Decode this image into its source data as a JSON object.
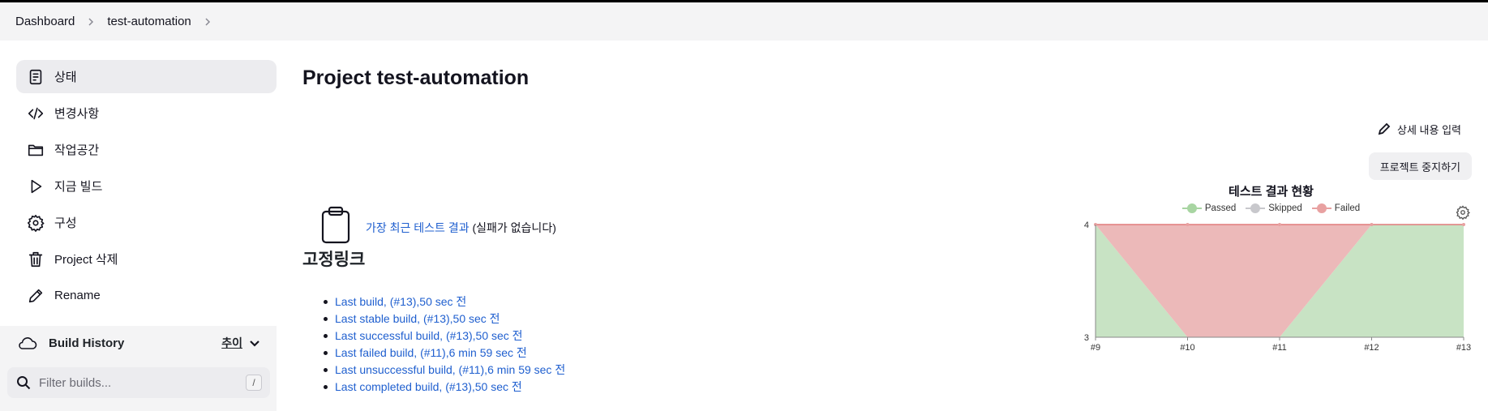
{
  "breadcrumb": {
    "items": [
      "Dashboard",
      "test-automation"
    ]
  },
  "sidebar": {
    "items": [
      {
        "label": "상태",
        "icon": "status-document-icon",
        "active": true
      },
      {
        "label": "변경사항",
        "icon": "code-icon"
      },
      {
        "label": "작업공간",
        "icon": "folder-icon"
      },
      {
        "label": "지금 빌드",
        "icon": "play-icon"
      },
      {
        "label": "구성",
        "icon": "gear-icon"
      },
      {
        "label": "Project 삭제",
        "icon": "trash-icon"
      },
      {
        "label": "Rename",
        "icon": "pencil-icon"
      }
    ]
  },
  "build_history": {
    "title": "Build History",
    "trend_label": "추이",
    "filter_placeholder": "Filter builds...",
    "shortcut": "/"
  },
  "main": {
    "title": "Project test-automation",
    "edit_description": "상세 내용 입력",
    "disable_project": "프로젝트 중지하기",
    "latest_test_link": "가장 최근 테스트 결과",
    "latest_test_status": "(실패가 없습니다)",
    "permalinks_title": "고정링크",
    "permalinks": [
      "Last build, (#13),50 sec 전",
      "Last stable build, (#13),50 sec 전",
      "Last successful build, (#13),50 sec 전",
      "Last failed build, (#11),6 min 59 sec 전",
      "Last unsuccessful build, (#11),6 min 59 sec 전",
      "Last completed build, (#13),50 sec 전"
    ]
  },
  "chart_data": {
    "type": "area",
    "title": "테스트 결과 현황",
    "categories": [
      "#9",
      "#10",
      "#11",
      "#12",
      "#13"
    ],
    "series": [
      {
        "name": "Passed",
        "values": [
          4,
          3,
          3,
          4,
          4
        ],
        "color": "#a8d5a2"
      },
      {
        "name": "Skipped",
        "values": [
          0,
          0,
          0,
          0,
          0
        ],
        "color": "#c8c8cc"
      },
      {
        "name": "Failed",
        "values": [
          0,
          1,
          1,
          0,
          0
        ],
        "color": "#e8a1a1"
      }
    ],
    "ylim": [
      3,
      4
    ],
    "yticks": [
      3,
      4
    ],
    "legend": "top",
    "grid": false
  },
  "colors": {
    "link": "#1f5fcf",
    "passed_fill": "#c8e3c4",
    "failed_fill": "#ecb9b9",
    "failed_line": "#e27b7b"
  }
}
